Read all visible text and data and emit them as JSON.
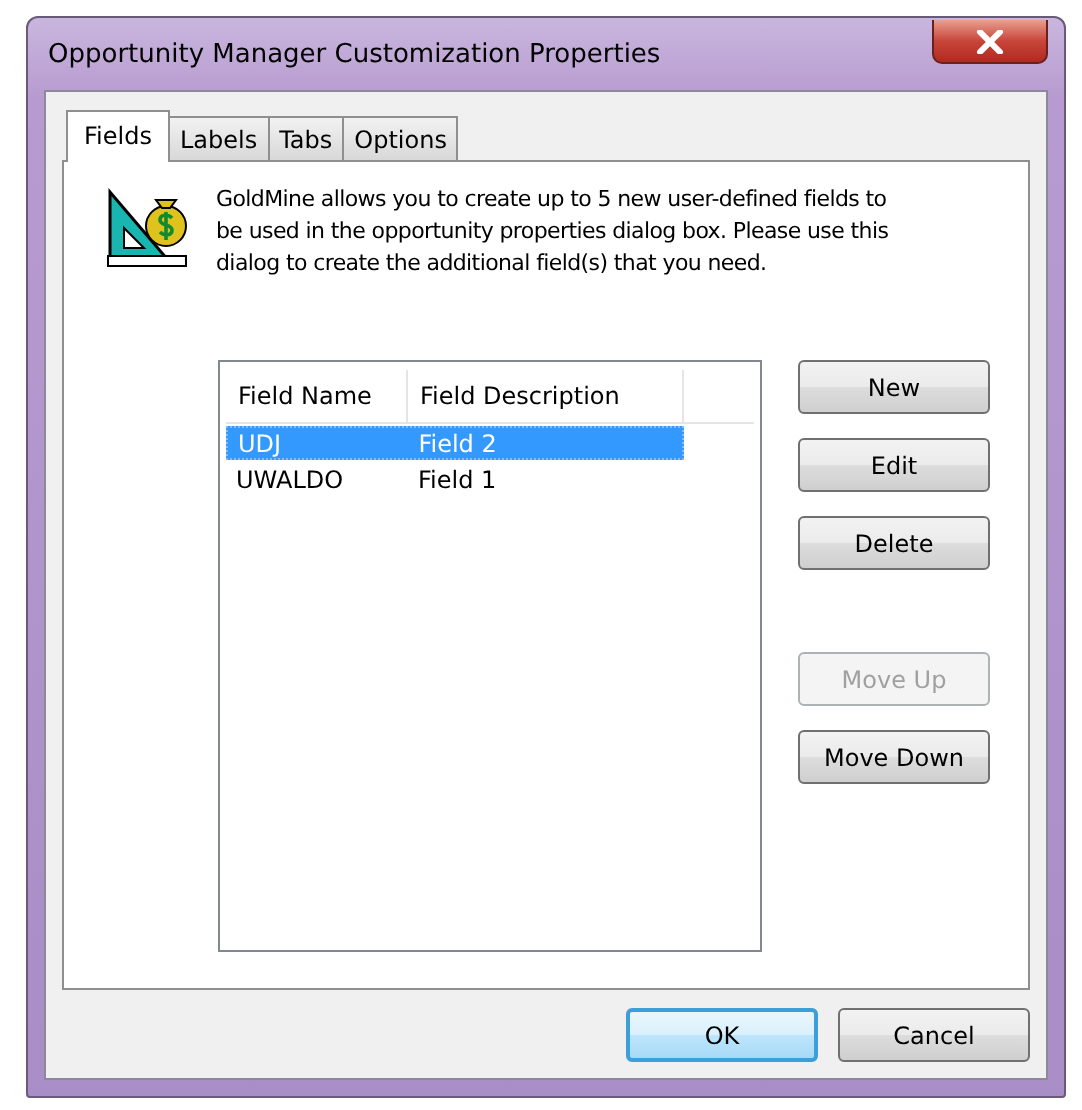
{
  "window": {
    "title": "Opportunity Manager Customization Properties"
  },
  "tabs": [
    {
      "label": "Fields",
      "selected": true
    },
    {
      "label": "Labels",
      "selected": false
    },
    {
      "label": "Tabs",
      "selected": false
    },
    {
      "label": "Options",
      "selected": false
    }
  ],
  "description": "GoldMine allows you to create up to 5 new user-defined fields to be used in the opportunity properties dialog box.  Please use this dialog to create the additional field(s) that you need.",
  "table": {
    "columns": [
      "Field Name",
      "Field Description"
    ],
    "rows": [
      {
        "cells": [
          "UDJ",
          "Field 2"
        ],
        "selected": true
      },
      {
        "cells": [
          "UWALDO",
          "Field 1"
        ],
        "selected": false
      }
    ]
  },
  "side_button_groups": [
    [
      {
        "label": "New",
        "disabled": false
      },
      {
        "label": "Edit",
        "disabled": false
      },
      {
        "label": "Delete",
        "disabled": false
      }
    ],
    [
      {
        "label": "Move Up",
        "disabled": true
      },
      {
        "label": "Move Down",
        "disabled": false
      }
    ]
  ],
  "footer_buttons": [
    {
      "label": "OK",
      "default": true
    },
    {
      "label": "Cancel",
      "default": false
    }
  ]
}
